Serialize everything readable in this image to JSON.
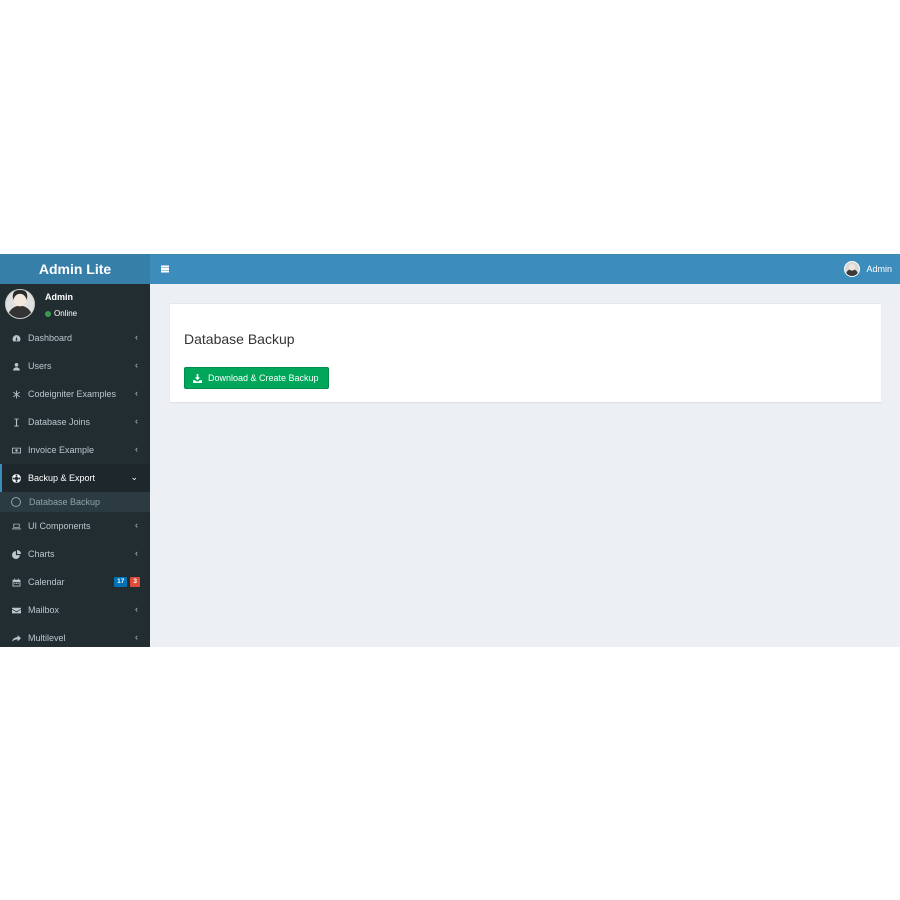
{
  "header": {
    "logo": "Admin Lite",
    "user_name": "Admin"
  },
  "sidebar": {
    "user": {
      "name": "Admin",
      "status": "Online"
    },
    "items": [
      {
        "label": "Dashboard",
        "icon": "dashboard-icon"
      },
      {
        "label": "Users",
        "icon": "user-icon"
      },
      {
        "label": "Codeigniter Examples",
        "icon": "snowflake-icon"
      },
      {
        "label": "Database Joins",
        "icon": "text-cursor-icon"
      },
      {
        "label": "Invoice Example",
        "icon": "money-icon"
      },
      {
        "label": "Backup & Export",
        "icon": "life-ring-icon",
        "active": true,
        "sub": [
          {
            "label": "Database Backup",
            "icon": "circle-outline-icon"
          }
        ]
      },
      {
        "label": "UI Components",
        "icon": "laptop-icon"
      },
      {
        "label": "Charts",
        "icon": "pie-chart-icon"
      },
      {
        "label": "Calendar",
        "icon": "calendar-icon",
        "badges": [
          "17",
          "3"
        ]
      },
      {
        "label": "Mailbox",
        "icon": "envelope-icon"
      },
      {
        "label": "Multilevel",
        "icon": "share-icon"
      }
    ]
  },
  "main": {
    "title": "Database Backup",
    "button_label": "Download & Create Backup"
  },
  "colors": {
    "header": "#3c8dbc",
    "logo_bg": "#367fa9",
    "sidebar": "#222d32",
    "content_bg": "#ecf0f5",
    "success": "#00a65a",
    "badge_blue": "#0073b7",
    "badge_red": "#dd4b39"
  }
}
